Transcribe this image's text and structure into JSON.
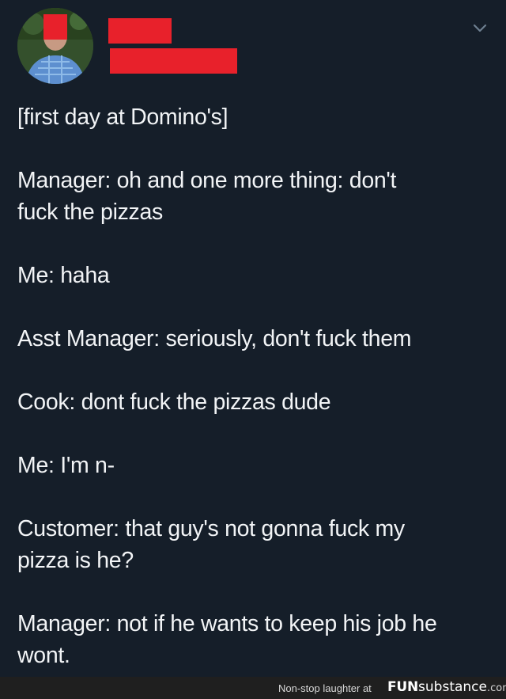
{
  "tweet": {
    "lines": [
      "[first day at Domino's]",
      "Manager: oh and one more thing: don't\nfuck the pizzas",
      "Me: haha",
      "Asst Manager: seriously, don't fuck them",
      "Cook: dont fuck the pizzas dude",
      "Me: I'm n-",
      "Customer: that guy's not gonna fuck my\npizza is he?",
      "Manager: not if he wants to keep his job he\nwont."
    ]
  },
  "footer": {
    "caption": "Non-stop laughter at",
    "brand_bold": "FUN",
    "brand_light": "substance",
    "brand_tld": ".com"
  },
  "colors": {
    "background": "#151e29",
    "text": "#f2f4f6",
    "redaction": "#e8212b",
    "footer_bg": "#1f1f1f"
  },
  "icons": {
    "menu": "chevron-down-icon"
  }
}
